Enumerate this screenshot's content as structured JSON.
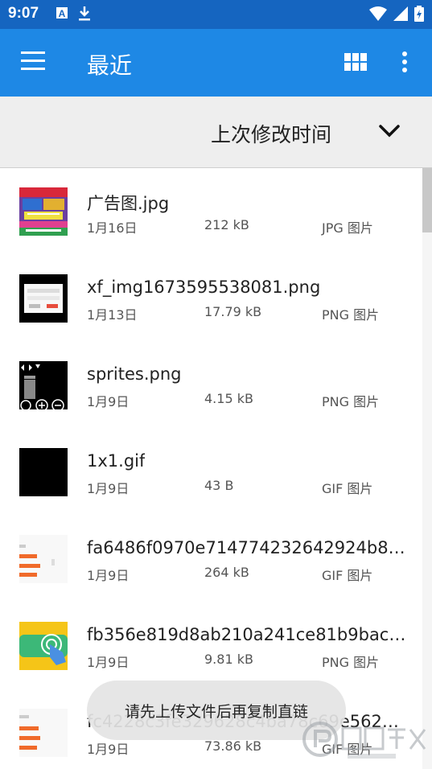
{
  "status_bar": {
    "time": "9:07"
  },
  "app_bar": {
    "title": "最近"
  },
  "sort_bar": {
    "label": "上次修改时间"
  },
  "files": [
    {
      "name": "广告图.jpg",
      "date": "1月16日",
      "size": "212 kB",
      "type": "JPG 图片",
      "thumb": "ad-image"
    },
    {
      "name": "xf_img1673595538081.png",
      "date": "1月13日",
      "size": "17.79 kB",
      "type": "PNG 图片",
      "thumb": "dialog"
    },
    {
      "name": "sprites.png",
      "date": "1月9日",
      "size": "4.15 kB",
      "type": "PNG 图片",
      "thumb": "sprites"
    },
    {
      "name": "1x1.gif",
      "date": "1月9日",
      "size": "43 B",
      "type": "GIF 图片",
      "thumb": "black"
    },
    {
      "name": "fa6486f0970e714774232642924b84…",
      "date": "1月9日",
      "size": "264 kB",
      "type": "GIF 图片",
      "thumb": "orange-ui"
    },
    {
      "name": "fb356e819d8ab210a241ce81b9bac3…",
      "date": "1月9日",
      "size": "9.81 kB",
      "type": "PNG 图片",
      "thumb": "green-tap"
    },
    {
      "name": "fc4228c3fe329628c4ba78c69e5620…",
      "date": "1月9日",
      "size": "73.86 kB",
      "type": "GIF 图片",
      "thumb": "orange-ui"
    }
  ],
  "toast": {
    "message": "请先上传文件后再复制直链"
  },
  "colors": {
    "status_bar": "#1565c0",
    "app_bar": "#1e88e5",
    "sort_bar": "#eeeeee"
  }
}
